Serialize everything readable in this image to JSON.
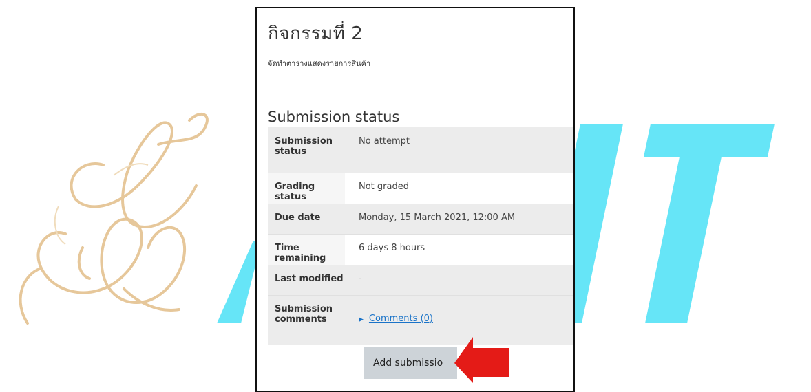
{
  "activity": {
    "title": "กิจกรรมที่ 2",
    "description": "จัดทำตารางแสดงรายการสินค้า"
  },
  "section_title": "Submission status",
  "rows": [
    {
      "label": "Submission status",
      "value": "No attempt"
    },
    {
      "label": "Grading status",
      "value": "Not graded"
    },
    {
      "label": "Due date",
      "value": "Monday, 15 March 2021, 12:00 AM"
    },
    {
      "label": "Time remaining",
      "value": "6 days 8 hours"
    },
    {
      "label": "Last modified",
      "value": "-"
    },
    {
      "label": "Submission comments",
      "value": "Comments (0)"
    }
  ],
  "add_button_label": "Add submissio",
  "watermark": {
    "text": "IT",
    "color": "#66e5f7",
    "logo_color": "#e6c79a"
  },
  "arrow_color": "#e41b17"
}
